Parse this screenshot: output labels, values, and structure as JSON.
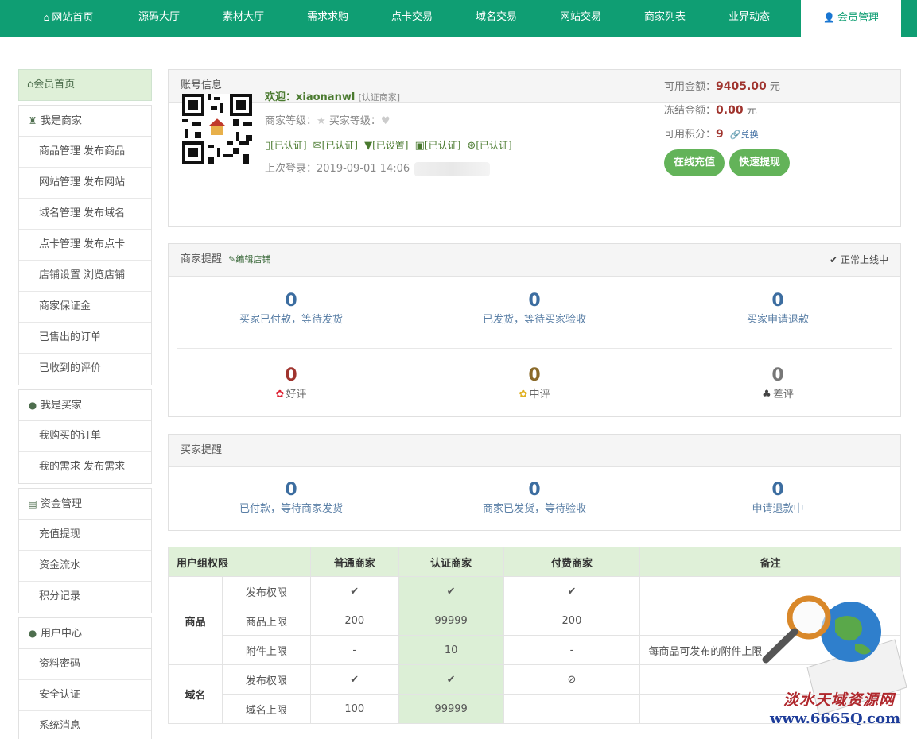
{
  "nav": {
    "items": [
      "网站首页",
      "源码大厅",
      "素材大厅",
      "需求求购",
      "点卡交易",
      "域名交易",
      "网站交易",
      "商家列表",
      "业界动态",
      "会员管理"
    ]
  },
  "sidebar": {
    "home": "会员首页",
    "groups": [
      {
        "title": "我是商家",
        "items": [
          "商品管理 发布商品",
          "网站管理 发布网站",
          "域名管理 发布域名",
          "点卡管理 发布点卡",
          "店铺设置 浏览店铺",
          "商家保证金",
          "已售出的订单",
          "已收到的评价"
        ]
      },
      {
        "title": "我是买家",
        "items": [
          "我购买的订单",
          "我的需求 发布需求"
        ]
      },
      {
        "title": "资金管理",
        "items": [
          "充值提现",
          "资金流水",
          "积分记录"
        ]
      },
      {
        "title": "用户中心",
        "items": [
          "资料密码",
          "安全认证",
          "系统消息"
        ]
      }
    ]
  },
  "account": {
    "title": "账号信息",
    "welcome": "欢迎：xiaonanwl",
    "tag": "[认证商家]",
    "seller_level": "商家等级：",
    "buyer_level": "买家等级：",
    "badges": [
      "[已认证]",
      "[已认证]",
      "[已设置]",
      "[已认证]",
      "[已认证]"
    ],
    "last_login": "上次登录：2019-09-01 14:06",
    "available_label": "可用金额：",
    "available_value": "9405.00",
    "frozen_label": "冻结金额：",
    "frozen_value": "0.00",
    "points_label": "可用积分：",
    "points_value": "9",
    "currency": "元",
    "exchange": "兑换",
    "recharge_btn": "在线充值",
    "withdraw_btn": "快速提现"
  },
  "seller": {
    "title": "商家提醒",
    "edit": "编辑店铺",
    "status": "正常上线中",
    "stats": [
      {
        "value": "0",
        "label": "买家已付款，等待发货"
      },
      {
        "value": "0",
        "label": "已发货，等待买家验收"
      },
      {
        "value": "0",
        "label": "买家申请退款"
      }
    ],
    "reviews": [
      {
        "value": "0",
        "label": "好评"
      },
      {
        "value": "0",
        "label": "中评"
      },
      {
        "value": "0",
        "label": "差评"
      }
    ]
  },
  "buyer": {
    "title": "买家提醒",
    "stats": [
      {
        "value": "0",
        "label": "已付款，等待商家发货"
      },
      {
        "value": "0",
        "label": "商家已发货，等待验收"
      },
      {
        "value": "0",
        "label": "申请退款中"
      }
    ]
  },
  "permissions": {
    "headers": [
      "用户组权限",
      "普通商家",
      "认证商家",
      "付费商家",
      "备注"
    ],
    "cat_goods": "商品",
    "cat_domain": "域名",
    "rows": [
      {
        "name": "发布权限",
        "normal": "✔",
        "verified": "✔",
        "paid": "✔",
        "note": ""
      },
      {
        "name": "商品上限",
        "normal": "200",
        "verified": "99999",
        "paid": "200",
        "note": ""
      },
      {
        "name": "附件上限",
        "normal": "-",
        "verified": "10",
        "paid": "-",
        "note": "每商品可发布的附件上限"
      },
      {
        "name": "发布权限",
        "normal": "✔",
        "verified": "✔",
        "paid": "⊘",
        "note": ""
      },
      {
        "name": "域名上限",
        "normal": "100",
        "verified": "99999",
        "paid": "",
        "note": ""
      }
    ]
  },
  "watermark": {
    "text": "淡水天域资源网",
    "url": "www.6665Q.com"
  }
}
